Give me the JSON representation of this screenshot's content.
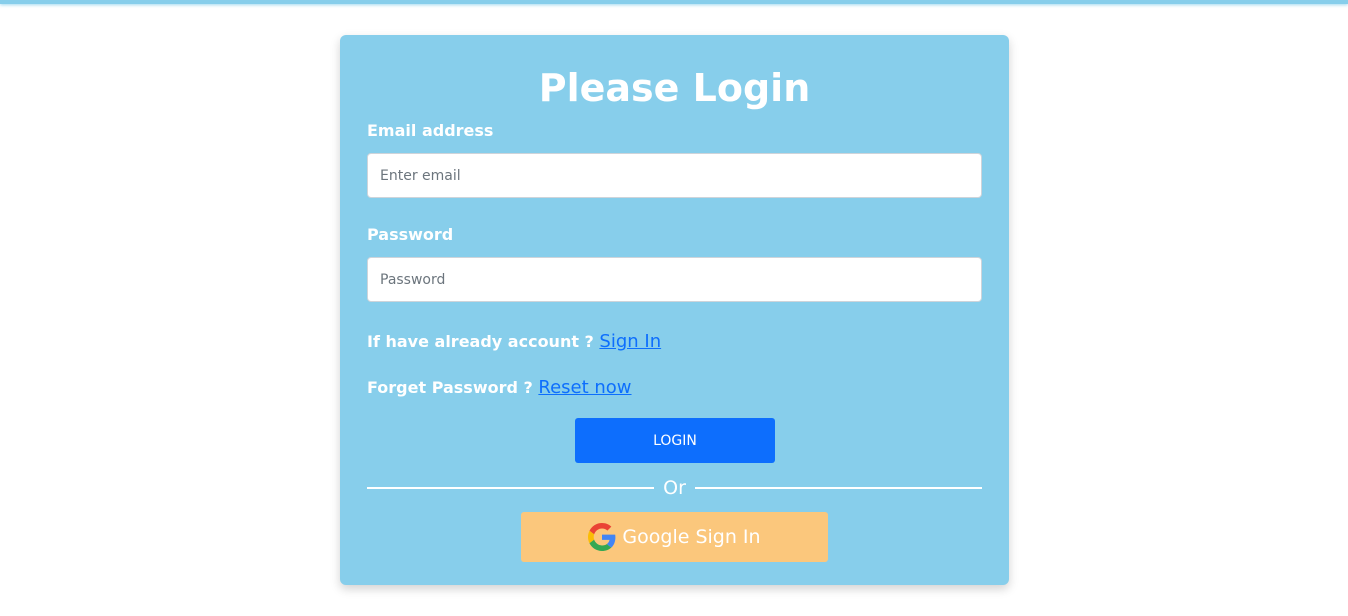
{
  "login_form": {
    "title": "Please Login",
    "email_label": "Email address",
    "email_placeholder": "Enter email",
    "password_label": "Password",
    "password_placeholder": "Password",
    "signin_prompt": "If have already account ? ",
    "signin_link": "Sign In",
    "reset_prompt": "Forget Password ? ",
    "reset_link": "Reset now",
    "login_button": "LOGIN",
    "divider_text": "Or",
    "google_button": "Google Sign In",
    "google_icon": "google-g-icon"
  },
  "colors": {
    "card_background": "#87ceeb",
    "primary_button": "#0d6efd",
    "link": "#0d6efd",
    "google_button": "#fbc77c",
    "text": "#ffffff"
  }
}
